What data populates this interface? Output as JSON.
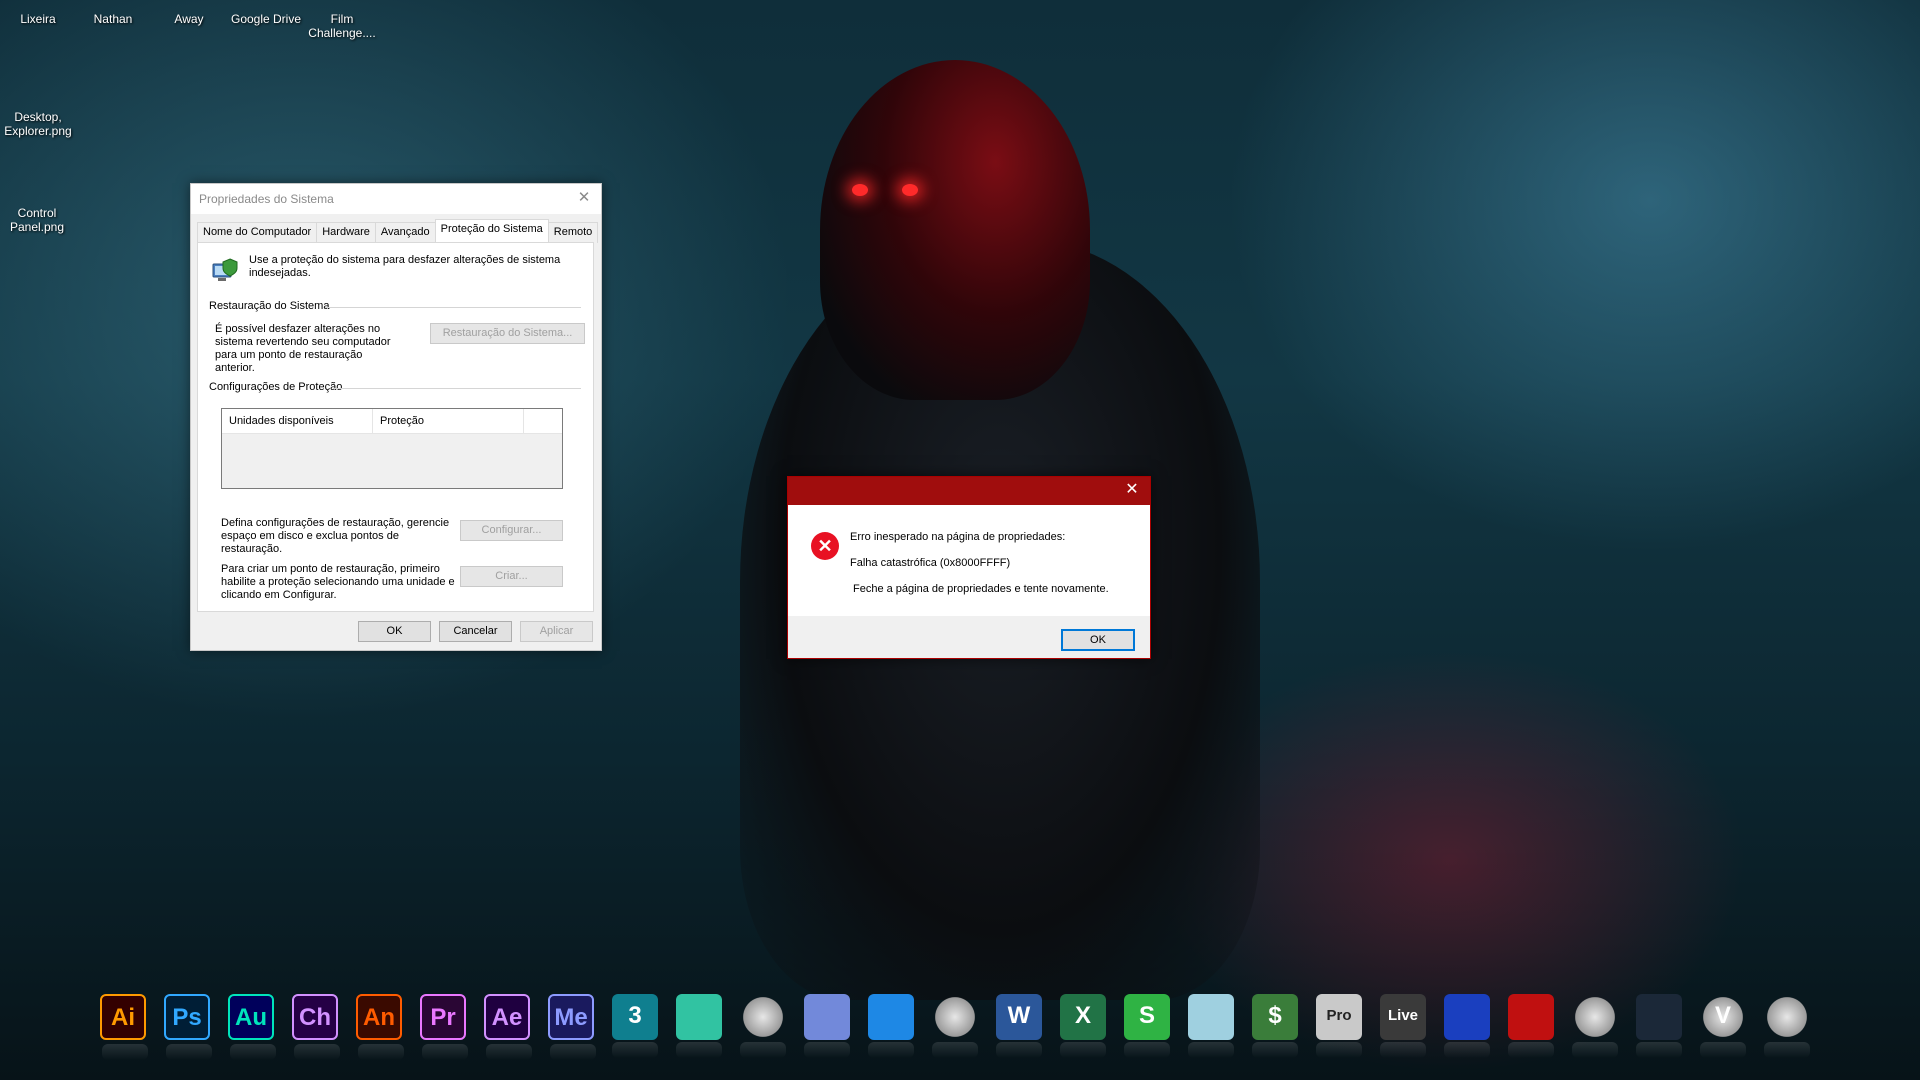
{
  "desktop": {
    "icons": [
      {
        "label": "Lixeira"
      },
      {
        "label": "Nathan"
      },
      {
        "label": "Away"
      },
      {
        "label": "Google Drive"
      },
      {
        "label": "Film Challenge...."
      },
      {
        "label": "Desktop, Explorer.png"
      },
      {
        "label": "Control Panel.png"
      }
    ]
  },
  "system_properties": {
    "title": "Propriedades do Sistema",
    "close": "✕",
    "tabs": [
      "Nome do Computador",
      "Hardware",
      "Avançado",
      "Proteção do Sistema",
      "Remoto"
    ],
    "active_tab": "Proteção do Sistema",
    "intro": "Use a proteção do sistema para desfazer alterações de sistema indesejadas.",
    "restore_group": "Restauração do Sistema",
    "restore_text": "É possível desfazer alterações no sistema revertendo seu computador para um ponto de restauração anterior.",
    "restore_button": "Restauração do Sistema...",
    "protection_group": "Configurações de Proteção",
    "col_drives": "Unidades disponíveis",
    "col_protection": "Proteção",
    "config_text": "Defina configurações de restauração, gerencie espaço em disco e exclua pontos de restauração.",
    "config_button": "Configurar...",
    "create_text": "Para criar um ponto de restauração, primeiro habilite a proteção selecionando uma unidade e clicando em Configurar.",
    "create_button": "Criar...",
    "ok": "OK",
    "cancel": "Cancelar",
    "apply": "Aplicar"
  },
  "error_dialog": {
    "close": "✕",
    "line1": "Erro inesperado na página de propriedades:",
    "line2": "Falha catastrófica (0x8000FFFF)",
    "line3": "Feche a página de propriedades e tente novamente.",
    "ok": "OK",
    "icon": "error-x-icon"
  },
  "dock": [
    {
      "name": "illustrator",
      "label": "Ai",
      "color": "#ff9a00",
      "bg": "#330000"
    },
    {
      "name": "photoshop",
      "label": "Ps",
      "color": "#31a8ff",
      "bg": "#001e36"
    },
    {
      "name": "audition",
      "label": "Au",
      "color": "#00e4bb",
      "bg": "#00005b"
    },
    {
      "name": "character-animator",
      "label": "Ch",
      "color": "#d291ff",
      "bg": "#250045"
    },
    {
      "name": "animate",
      "label": "An",
      "color": "#ff5c00",
      "bg": "#3a0a00"
    },
    {
      "name": "premiere",
      "label": "Pr",
      "color": "#ea77ff",
      "bg": "#2a0634"
    },
    {
      "name": "after-effects",
      "label": "Ae",
      "color": "#d291ff",
      "bg": "#1f0040"
    },
    {
      "name": "media-encoder",
      "label": "Me",
      "color": "#8d9bff",
      "bg": "#1a1a5e"
    },
    {
      "name": "3ds-max",
      "label": "3",
      "color": "#ffffff",
      "bg": "#0f7f8f"
    },
    {
      "name": "streamlabs",
      "label": "",
      "color": "#ffffff",
      "bg": "#31c3a2"
    },
    {
      "name": "cocktail",
      "label": "",
      "color": "#ffffff",
      "bg": "transparent"
    },
    {
      "name": "discord",
      "label": "",
      "color": "#ffffff",
      "bg": "#7289da"
    },
    {
      "name": "cloud-upload",
      "label": "",
      "color": "#ffffff",
      "bg": "#1e88e5"
    },
    {
      "name": "chrome",
      "label": "",
      "color": "#ffffff",
      "bg": "transparent"
    },
    {
      "name": "word",
      "label": "W",
      "color": "#ffffff",
      "bg": "#2b579a"
    },
    {
      "name": "excel",
      "label": "X",
      "color": "#ffffff",
      "bg": "#217346"
    },
    {
      "name": "sumo",
      "label": "S",
      "color": "#ffffff",
      "bg": "#2fb344"
    },
    {
      "name": "notes",
      "label": "",
      "color": "#ffffff",
      "bg": "#9fd0e0"
    },
    {
      "name": "money-manager",
      "label": "$",
      "color": "#ffffff",
      "bg": "#3a7d3a"
    },
    {
      "name": "pro-app",
      "label": "Pro",
      "color": "#222222",
      "bg": "#c9c9c9"
    },
    {
      "name": "ableton-live",
      "label": "Live",
      "color": "#ffffff",
      "bg": "#3a3a3a"
    },
    {
      "name": "audacity",
      "label": "",
      "color": "#ffffff",
      "bg": "#1a3fbf"
    },
    {
      "name": "red-box",
      "label": "",
      "color": "#ffffff",
      "bg": "#c01010"
    },
    {
      "name": "xsplit",
      "label": "",
      "color": "#ffffff",
      "bg": "transparent"
    },
    {
      "name": "steam",
      "label": "",
      "color": "#ffffff",
      "bg": "#1b2838"
    },
    {
      "name": "gta-v",
      "label": "V",
      "color": "#ffffff",
      "bg": "transparent"
    },
    {
      "name": "need-for-speed",
      "label": "",
      "color": "#ffffff",
      "bg": "transparent"
    }
  ]
}
